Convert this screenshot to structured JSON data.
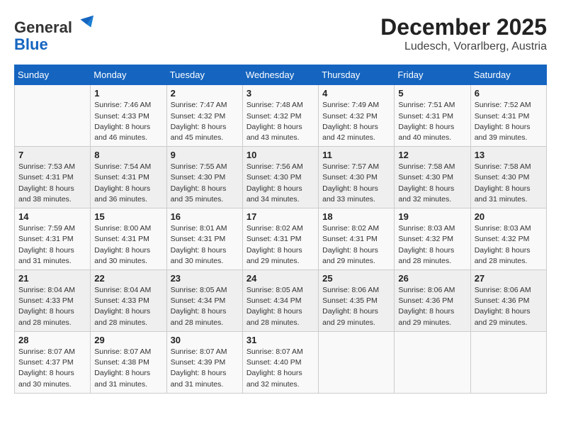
{
  "header": {
    "logo_line1": "General",
    "logo_line2": "Blue",
    "month": "December 2025",
    "location": "Ludesch, Vorarlberg, Austria"
  },
  "weekdays": [
    "Sunday",
    "Monday",
    "Tuesday",
    "Wednesday",
    "Thursday",
    "Friday",
    "Saturday"
  ],
  "weeks": [
    [
      {
        "day": "",
        "info": ""
      },
      {
        "day": "1",
        "info": "Sunrise: 7:46 AM\nSunset: 4:33 PM\nDaylight: 8 hours\nand 46 minutes."
      },
      {
        "day": "2",
        "info": "Sunrise: 7:47 AM\nSunset: 4:32 PM\nDaylight: 8 hours\nand 45 minutes."
      },
      {
        "day": "3",
        "info": "Sunrise: 7:48 AM\nSunset: 4:32 PM\nDaylight: 8 hours\nand 43 minutes."
      },
      {
        "day": "4",
        "info": "Sunrise: 7:49 AM\nSunset: 4:32 PM\nDaylight: 8 hours\nand 42 minutes."
      },
      {
        "day": "5",
        "info": "Sunrise: 7:51 AM\nSunset: 4:31 PM\nDaylight: 8 hours\nand 40 minutes."
      },
      {
        "day": "6",
        "info": "Sunrise: 7:52 AM\nSunset: 4:31 PM\nDaylight: 8 hours\nand 39 minutes."
      }
    ],
    [
      {
        "day": "7",
        "info": "Sunrise: 7:53 AM\nSunset: 4:31 PM\nDaylight: 8 hours\nand 38 minutes."
      },
      {
        "day": "8",
        "info": "Sunrise: 7:54 AM\nSunset: 4:31 PM\nDaylight: 8 hours\nand 36 minutes."
      },
      {
        "day": "9",
        "info": "Sunrise: 7:55 AM\nSunset: 4:30 PM\nDaylight: 8 hours\nand 35 minutes."
      },
      {
        "day": "10",
        "info": "Sunrise: 7:56 AM\nSunset: 4:30 PM\nDaylight: 8 hours\nand 34 minutes."
      },
      {
        "day": "11",
        "info": "Sunrise: 7:57 AM\nSunset: 4:30 PM\nDaylight: 8 hours\nand 33 minutes."
      },
      {
        "day": "12",
        "info": "Sunrise: 7:58 AM\nSunset: 4:30 PM\nDaylight: 8 hours\nand 32 minutes."
      },
      {
        "day": "13",
        "info": "Sunrise: 7:58 AM\nSunset: 4:30 PM\nDaylight: 8 hours\nand 31 minutes."
      }
    ],
    [
      {
        "day": "14",
        "info": "Sunrise: 7:59 AM\nSunset: 4:31 PM\nDaylight: 8 hours\nand 31 minutes."
      },
      {
        "day": "15",
        "info": "Sunrise: 8:00 AM\nSunset: 4:31 PM\nDaylight: 8 hours\nand 30 minutes."
      },
      {
        "day": "16",
        "info": "Sunrise: 8:01 AM\nSunset: 4:31 PM\nDaylight: 8 hours\nand 30 minutes."
      },
      {
        "day": "17",
        "info": "Sunrise: 8:02 AM\nSunset: 4:31 PM\nDaylight: 8 hours\nand 29 minutes."
      },
      {
        "day": "18",
        "info": "Sunrise: 8:02 AM\nSunset: 4:31 PM\nDaylight: 8 hours\nand 29 minutes."
      },
      {
        "day": "19",
        "info": "Sunrise: 8:03 AM\nSunset: 4:32 PM\nDaylight: 8 hours\nand 28 minutes."
      },
      {
        "day": "20",
        "info": "Sunrise: 8:03 AM\nSunset: 4:32 PM\nDaylight: 8 hours\nand 28 minutes."
      }
    ],
    [
      {
        "day": "21",
        "info": "Sunrise: 8:04 AM\nSunset: 4:33 PM\nDaylight: 8 hours\nand 28 minutes."
      },
      {
        "day": "22",
        "info": "Sunrise: 8:04 AM\nSunset: 4:33 PM\nDaylight: 8 hours\nand 28 minutes."
      },
      {
        "day": "23",
        "info": "Sunrise: 8:05 AM\nSunset: 4:34 PM\nDaylight: 8 hours\nand 28 minutes."
      },
      {
        "day": "24",
        "info": "Sunrise: 8:05 AM\nSunset: 4:34 PM\nDaylight: 8 hours\nand 28 minutes."
      },
      {
        "day": "25",
        "info": "Sunrise: 8:06 AM\nSunset: 4:35 PM\nDaylight: 8 hours\nand 29 minutes."
      },
      {
        "day": "26",
        "info": "Sunrise: 8:06 AM\nSunset: 4:36 PM\nDaylight: 8 hours\nand 29 minutes."
      },
      {
        "day": "27",
        "info": "Sunrise: 8:06 AM\nSunset: 4:36 PM\nDaylight: 8 hours\nand 29 minutes."
      }
    ],
    [
      {
        "day": "28",
        "info": "Sunrise: 8:07 AM\nSunset: 4:37 PM\nDaylight: 8 hours\nand 30 minutes."
      },
      {
        "day": "29",
        "info": "Sunrise: 8:07 AM\nSunset: 4:38 PM\nDaylight: 8 hours\nand 31 minutes."
      },
      {
        "day": "30",
        "info": "Sunrise: 8:07 AM\nSunset: 4:39 PM\nDaylight: 8 hours\nand 31 minutes."
      },
      {
        "day": "31",
        "info": "Sunrise: 8:07 AM\nSunset: 4:40 PM\nDaylight: 8 hours\nand 32 minutes."
      },
      {
        "day": "",
        "info": ""
      },
      {
        "day": "",
        "info": ""
      },
      {
        "day": "",
        "info": ""
      }
    ]
  ]
}
